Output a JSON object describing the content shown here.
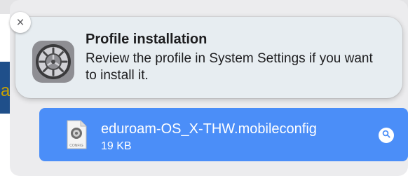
{
  "notification": {
    "close_label": "×",
    "icon": "system-settings-gear-icon",
    "title": "Profile installation",
    "body": "Review the profile in System Settings if you want to install it."
  },
  "download": {
    "file_icon": "config-file-icon",
    "file_icon_label": "CONFIG",
    "file_name": "eduroam-OS_X-THW.mobileconfig",
    "file_size": "19 KB",
    "reveal_icon": "magnifier-icon"
  },
  "background": {
    "partial_letter": "a"
  },
  "colors": {
    "accent": "#4b8ef8",
    "notification_bg": "#e7edf1",
    "panel_bg": "#ececee"
  }
}
